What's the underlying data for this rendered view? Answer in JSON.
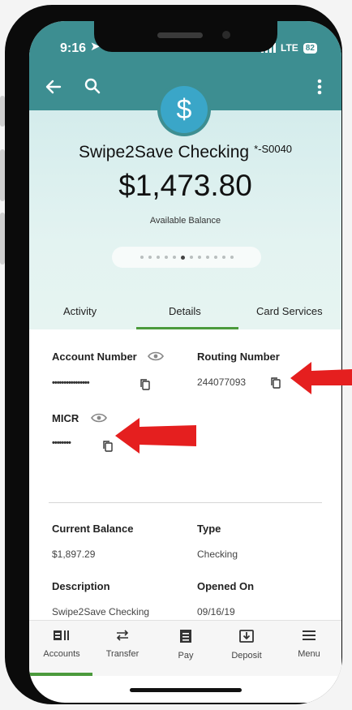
{
  "status_bar": {
    "time": "9:16",
    "network": "LTE",
    "battery": "82"
  },
  "account": {
    "name": "Swipe2Save Checking",
    "suffix": "*-S0040",
    "balance": "$1,473.80",
    "balance_label": "Available Balance",
    "pager": {
      "total": 12,
      "active_index": 5
    }
  },
  "tabs": [
    {
      "label": "Activity"
    },
    {
      "label": "Details"
    },
    {
      "label": "Card Services"
    }
  ],
  "details": {
    "account_number": {
      "label": "Account Number",
      "value": "••••••••••••••••"
    },
    "routing_number": {
      "label": "Routing Number",
      "value": "244077093"
    },
    "micr": {
      "label": "MICR",
      "value": "••••••••"
    },
    "current_balance": {
      "label": "Current Balance",
      "value": "$1,897.29"
    },
    "type": {
      "label": "Type",
      "value": "Checking"
    },
    "description": {
      "label": "Description",
      "value": "Swipe2Save Checking"
    },
    "opened_on": {
      "label": "Opened On",
      "value": "09/16/19"
    }
  },
  "bottom_nav": [
    {
      "label": "Accounts",
      "icon": "accounts-icon"
    },
    {
      "label": "Transfer",
      "icon": "transfer-icon"
    },
    {
      "label": "Pay",
      "icon": "pay-icon"
    },
    {
      "label": "Deposit",
      "icon": "deposit-icon"
    },
    {
      "label": "Menu",
      "icon": "menu-icon"
    }
  ],
  "colors": {
    "header": "#3d8e91",
    "accent": "#4b9a3c",
    "icon_circle": "#3aa6c8",
    "annotation_arrow": "#e51f1f"
  }
}
